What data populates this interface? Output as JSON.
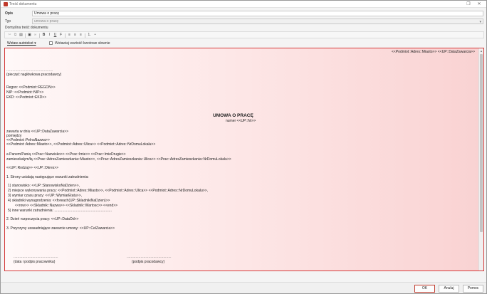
{
  "window": {
    "title": "Treść dokumentu"
  },
  "form": {
    "opis_label": "Opis",
    "opis_value": "Umowa o pracę",
    "typ_label": "Typ",
    "typ_value": "umowa o pracę",
    "section_label": "Domyślna treść dokumentu"
  },
  "options": {
    "insert_link": "Wstaw autotekst",
    "check_label": "Wstawiaj wartość kwotowe słownie"
  },
  "document": {
    "place_date": "<<Podmiot::Adres::Miasto>> <<UP::DataZawarcia>>",
    "stamp_dots": "...............................................",
    "stamp_label": "(pieczęć nagłówkowa pracodawcy)",
    "regon": "Regon: <<Podmiot::REGON>>",
    "nip": "NIP:     <<Podmiot::NIP>>",
    "ekd": "EKD:    <<Podmiot::EKD>>",
    "title": "UMOWA O PRACĘ",
    "number": "numer <<UP::Nr>>",
    "concluded": "zawarta w dniu <<UP::DataZawarcia>>",
    "between": "pomiędzy",
    "employer_name": "<<Podmiot::PelnaNazwa>>",
    "employer_address": "<<Podmiot::Adres::Miasto>>, <<Podmiot::Adres::Ulica>> <<Podmiot::Adres::NrDomuLokalu>>",
    "employee_line": "a Panem/Panią <<Prac::Nazwisko>> <<Prac::Imie>> <<Prac::ImieDrugie>>",
    "employee_address": "zamieszkałym/łą <<Prac::AdresZamieszkania::Miasto>>, <<Prac::AdresZamieszkania::Ulica>> <<Prac::AdresZamieszkania::NrDomuLokalu>>",
    "kind_period": "<<UP::Rodzaj>> <<UP::Okres>>",
    "section1": "1. Strony ustalają następujące warunki zatrudnienia:",
    "item1": "1) stanowisko: <<UP::StanowiskoNaDzien>>,",
    "item2": "2) miejsce wykonywania pracy: <<Podmiot::Adres::Miasto>>, <<Podmiot::Adres::Ulica>> <<Podmiot::Adres::NrDomuLokalu>>,",
    "item3": "3) wymiar czasu pracy: <<UP::WymiarEtatu>>,",
    "item4": "4) składniki wynagrodzenia: <<foreach(UP::SkladnikiNaDzien)>>",
    "item4b": "<<row>> <<Skladnik::Nazwa>> <<Skladnik::Wartosc>> <<end>>",
    "item5": "5) inne warunki zatrudnienia: ..........................................................",
    "section2": "2. Dzień rozpoczęcia pracy: <<UP::DataOd>>",
    "section3": "3. Przyczyny uzasadniające zawarcie umowy: <<UP::CelZawarcia>>",
    "sig_dots_left": ".............................................",
    "sig_label_left": "(data i podpis pracownika)",
    "sig_dots_right": ".............................................",
    "sig_label_right": "(podpis pracodawcy)"
  },
  "buttons": {
    "ok": "OK",
    "cancel": "Anuluj",
    "help": "Pomoc"
  }
}
